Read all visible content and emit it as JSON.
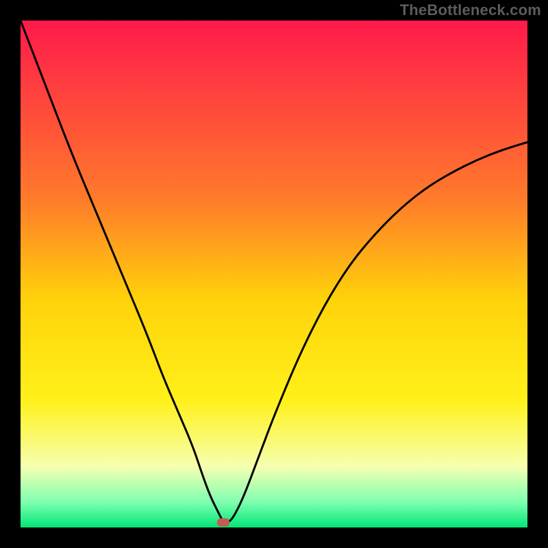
{
  "watermark": "TheBottleneck.com",
  "chart_data": {
    "type": "line",
    "title": "",
    "xlabel": "",
    "ylabel": "",
    "xlim": [
      0,
      100
    ],
    "ylim": [
      0,
      100
    ],
    "grid": false,
    "background_gradient": {
      "direction": "vertical",
      "stops": [
        {
          "offset": 0.0,
          "color": "#ff1a4b"
        },
        {
          "offset": 0.35,
          "color": "#ff7a2b"
        },
        {
          "offset": 0.55,
          "color": "#ffd20a"
        },
        {
          "offset": 0.75,
          "color": "#fff11a"
        },
        {
          "offset": 0.88,
          "color": "#f6ffb0"
        },
        {
          "offset": 0.95,
          "color": "#7fffb0"
        },
        {
          "offset": 1.0,
          "color": "#00e676"
        }
      ]
    },
    "marker": {
      "x": 40,
      "y": 1,
      "color": "#c75b50",
      "shape": "rounded-rect"
    },
    "series": [
      {
        "name": "bottleneck-curve",
        "color": "#000000",
        "x": [
          0,
          5,
          10,
          15,
          20,
          25,
          28,
          31,
          34,
          36,
          37.5,
          39,
          40,
          41,
          42,
          44,
          47,
          50,
          55,
          60,
          65,
          70,
          75,
          80,
          85,
          90,
          95,
          100
        ],
        "y": [
          100,
          87,
          74,
          62,
          50,
          38,
          30,
          23,
          16,
          10,
          6,
          3,
          1,
          1,
          2,
          6,
          14,
          22,
          34,
          44,
          52,
          58,
          63,
          67,
          70,
          72.5,
          74.5,
          76
        ]
      }
    ]
  }
}
